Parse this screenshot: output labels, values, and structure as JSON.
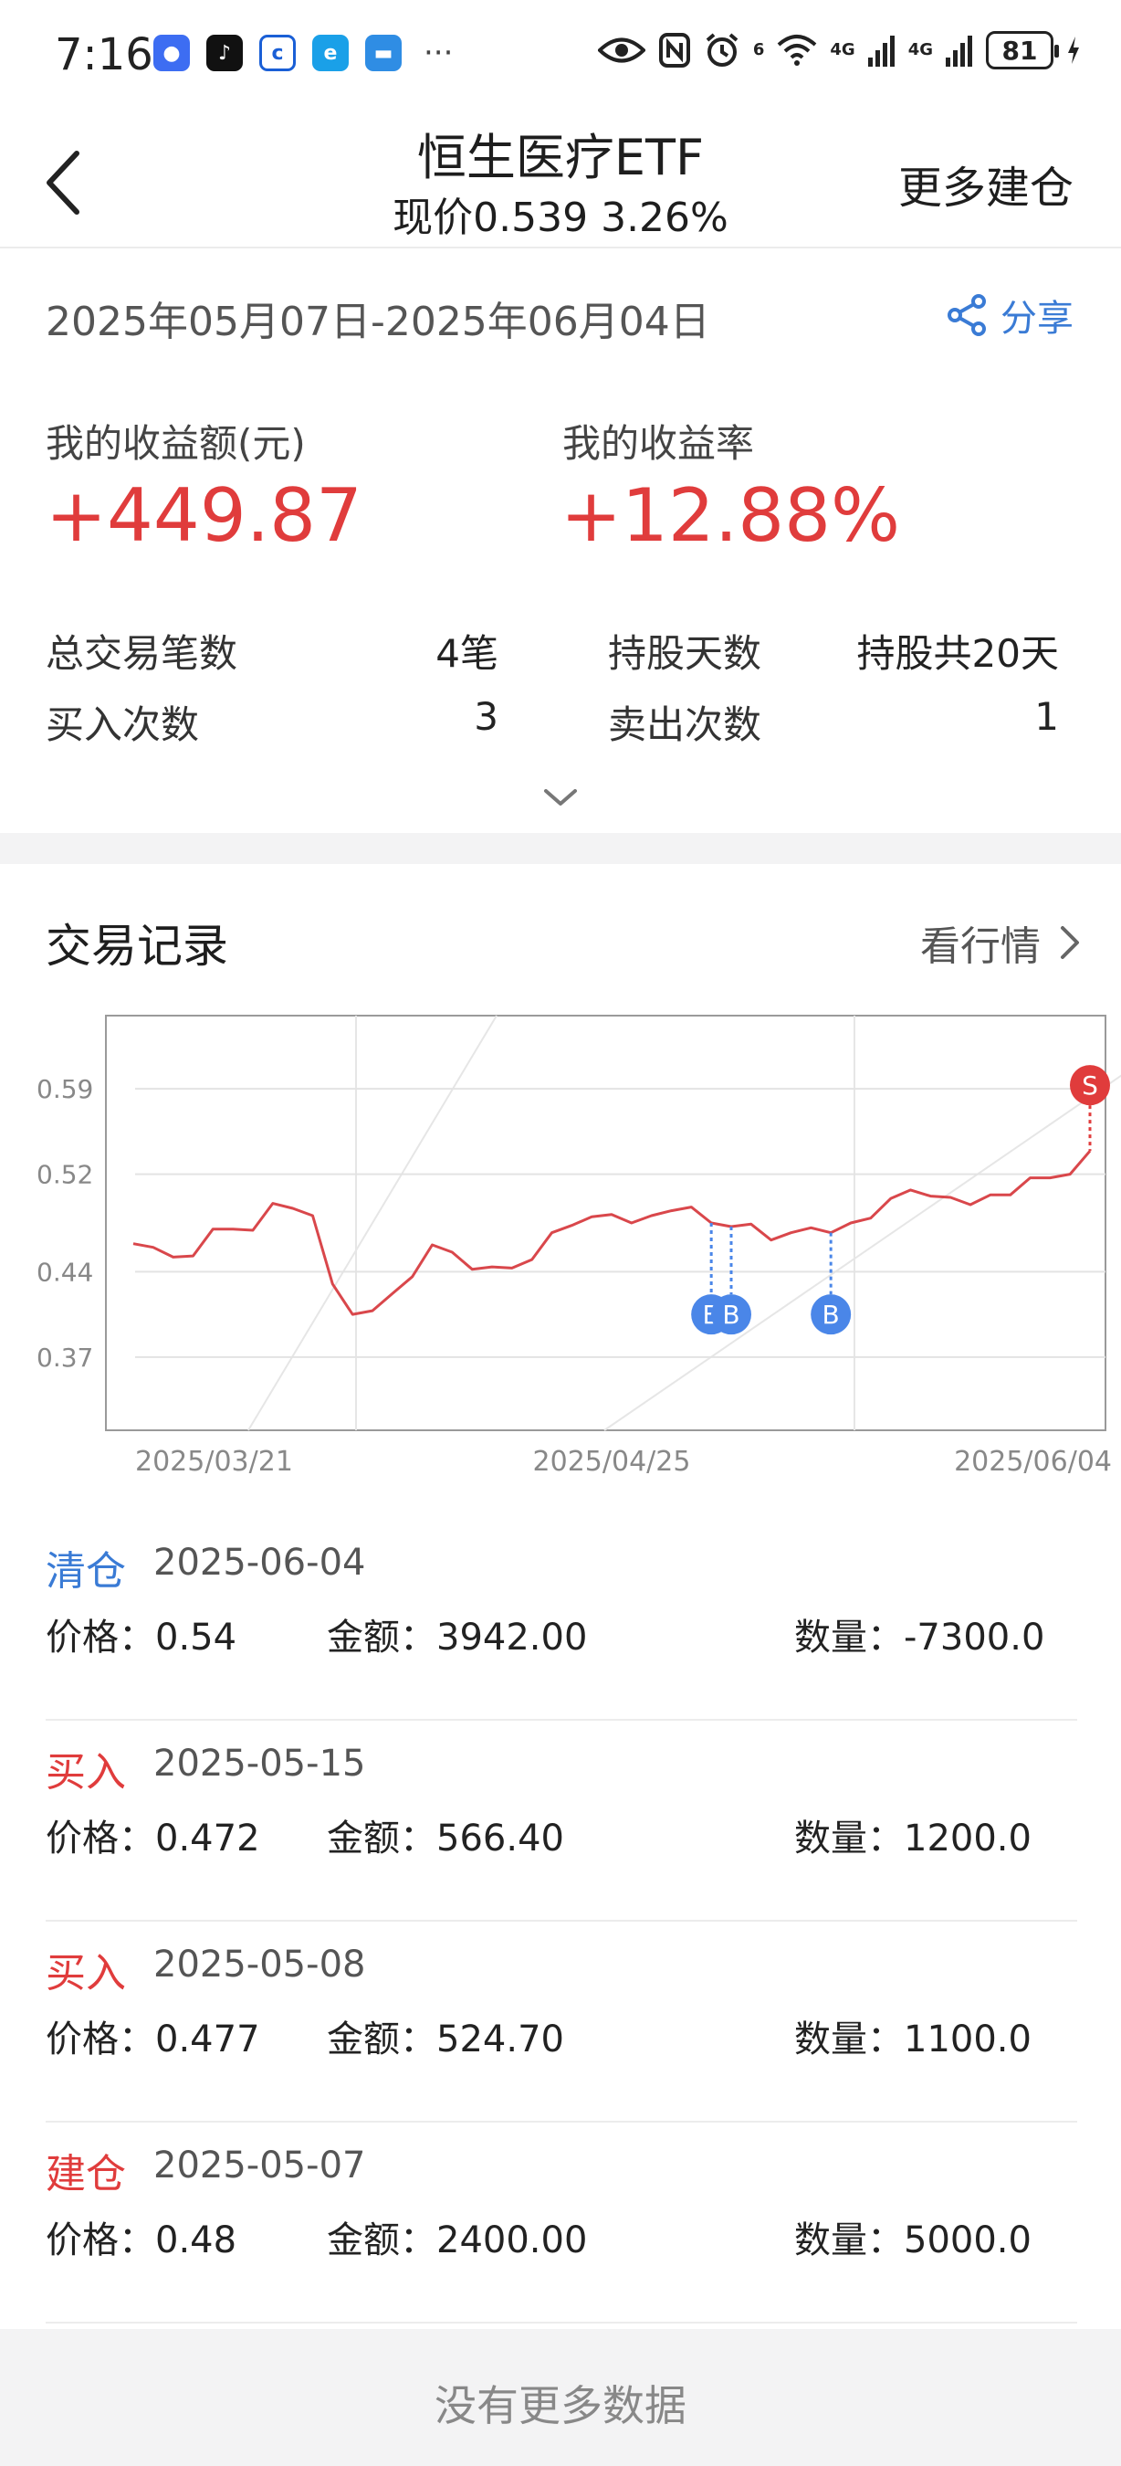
{
  "status_bar": {
    "time": "7:16",
    "battery": "81",
    "net1": "4G",
    "net2": "4G",
    "wifi_num": "6",
    "icons": [
      "eye-icon",
      "nfc-icon",
      "alarm-icon",
      "wifi-icon",
      "signal-icon",
      "signal-icon",
      "battery-icon"
    ]
  },
  "header": {
    "title": "恒生医疗ETF",
    "subtitle": "现价0.539 3.26%",
    "right_action": "更多建仓"
  },
  "summary": {
    "date_range": "2025年05月07日-2025年06月04日",
    "share_label": "分享",
    "profit_label": "我的收益额(元)",
    "profit_value": "+449.87",
    "rate_label": "我的收益率",
    "rate_value": "+12.88%",
    "stats": [
      {
        "label": "总交易笔数",
        "value": "4笔"
      },
      {
        "label": "持股天数",
        "value": "持股共20天"
      },
      {
        "label": "买入次数",
        "value": "3"
      },
      {
        "label": "卖出次数",
        "value": "1"
      }
    ]
  },
  "trades_section": {
    "title": "交易记录",
    "market_link": "看行情"
  },
  "chart_data": {
    "type": "line",
    "x_tick_labels": [
      "2025/03/21",
      "2025/04/25",
      "2025/06/04"
    ],
    "y_tick_labels": [
      "0.59",
      "0.52",
      "0.44",
      "0.37"
    ],
    "ylim": [
      0.31,
      0.65
    ],
    "grid": true,
    "colors": {
      "line": "#d9474b",
      "buy": "#4a86e8",
      "sell": "#e03c3c"
    },
    "series": [
      {
        "values": [
          0.463,
          0.46,
          0.452,
          0.453,
          0.475,
          0.475,
          0.474,
          0.496,
          0.492,
          0.486,
          0.43,
          0.405,
          0.408,
          0.422,
          0.436,
          0.462,
          0.456,
          0.442,
          0.444,
          0.443,
          0.45,
          0.472,
          0.478,
          0.485,
          0.487,
          0.48,
          0.486,
          0.49,
          0.493,
          0.48,
          0.477,
          0.479,
          0.466,
          0.472,
          0.476,
          0.472,
          0.48,
          0.484,
          0.5,
          0.507,
          0.502,
          0.501,
          0.495,
          0.503,
          0.503,
          0.517,
          0.517,
          0.52,
          0.539
        ]
      }
    ],
    "markers": [
      {
        "label": "B",
        "index": 29,
        "kind": "buy"
      },
      {
        "label": "B",
        "index": 30,
        "kind": "buy"
      },
      {
        "label": "B",
        "index": 35,
        "kind": "buy"
      },
      {
        "label": "S",
        "index": 48,
        "kind": "sell"
      }
    ]
  },
  "trades": [
    {
      "type": "清仓",
      "type_color": "#3a7bd5",
      "date": "2025-06-04",
      "price_label": "价格：",
      "price": "0.54",
      "amount_label": "金额：",
      "amount": "3942.00",
      "qty_label": "数量：",
      "qty": "-7300.0"
    },
    {
      "type": "买入",
      "type_color": "#e03c3c",
      "date": "2025-05-15",
      "price_label": "价格：",
      "price": "0.472",
      "amount_label": "金额：",
      "amount": "566.40",
      "qty_label": "数量：",
      "qty": "1200.0"
    },
    {
      "type": "买入",
      "type_color": "#e03c3c",
      "date": "2025-05-08",
      "price_label": "价格：",
      "price": "0.477",
      "amount_label": "金额：",
      "amount": "524.70",
      "qty_label": "数量：",
      "qty": "1100.0"
    },
    {
      "type": "建仓",
      "type_color": "#e03c3c",
      "date": "2025-05-07",
      "price_label": "价格：",
      "price": "0.48",
      "amount_label": "金额：",
      "amount": "2400.00",
      "qty_label": "数量：",
      "qty": "5000.0"
    }
  ],
  "footer": {
    "text": "没有更多数据"
  }
}
